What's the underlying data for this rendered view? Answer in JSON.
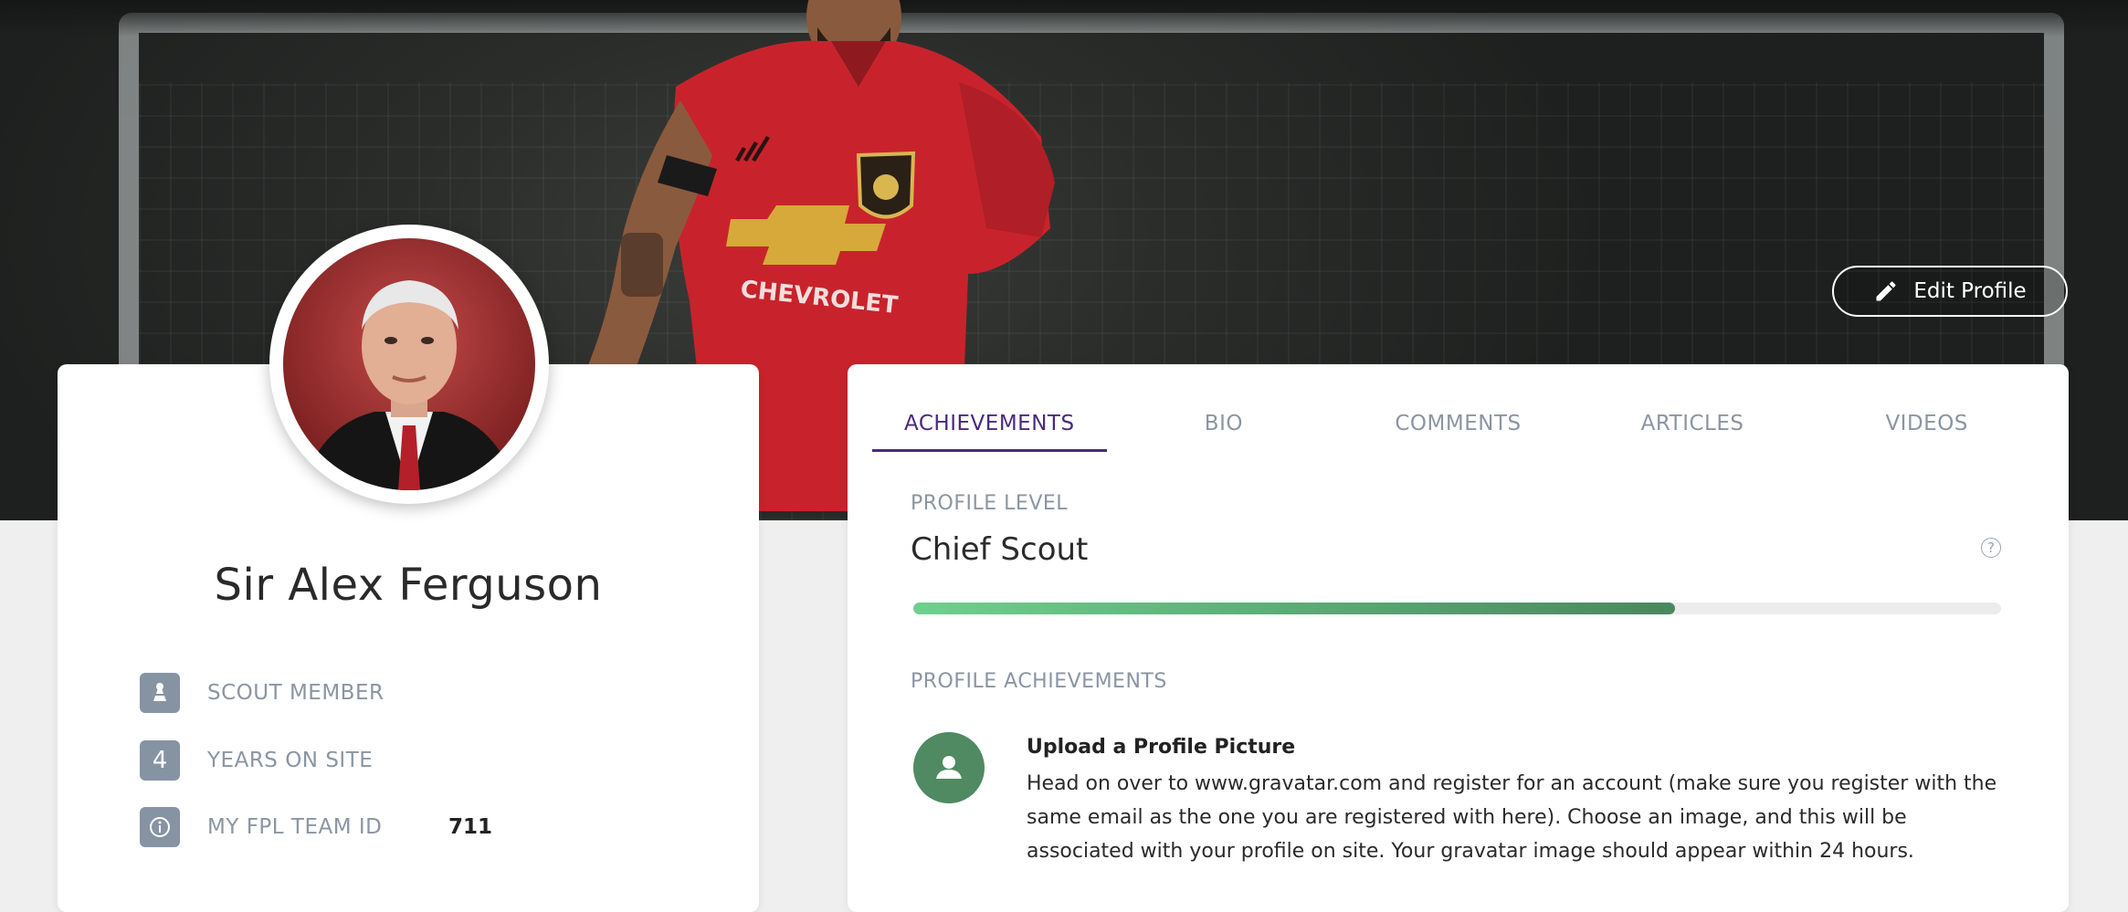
{
  "header": {
    "edit_profile_label": "Edit Profile"
  },
  "profile": {
    "name": "Sir Alex Ferguson",
    "info": [
      {
        "icon": "chess-pawn-icon",
        "label": "SCOUT MEMBER",
        "value": ""
      },
      {
        "icon": "number-badge",
        "badge": "4",
        "label": "YEARS ON SITE",
        "value": ""
      },
      {
        "icon": "info-icon",
        "label": "MY FPL TEAM ID",
        "value": "711"
      }
    ]
  },
  "tabs": [
    {
      "label": "ACHIEVEMENTS",
      "active": true
    },
    {
      "label": "BIO",
      "active": false
    },
    {
      "label": "COMMENTS",
      "active": false
    },
    {
      "label": "ARTICLES",
      "active": false
    },
    {
      "label": "VIDEOS",
      "active": false
    }
  ],
  "level": {
    "section_label": "PROFILE LEVEL",
    "value": "Chief Scout",
    "progress": 0.7
  },
  "achievements": {
    "section_label": "PROFILE ACHIEVEMENTS",
    "items": [
      {
        "icon": "user-icon",
        "title": "Upload a Profile Picture",
        "description": "Head on over to www.gravatar.com and register for an account (make sure you register with the same email as the one you are registered with here). Choose an image, and this will be associated with your profile on site. Your gravatar image should appear within 24 hours."
      }
    ]
  },
  "colors": {
    "accent": "#4a2a7d",
    "progress_start": "#6fd08d",
    "progress_end": "#4a875f",
    "icon_bg": "#8693a3",
    "achievement_icon_bg": "#4f8a62"
  }
}
